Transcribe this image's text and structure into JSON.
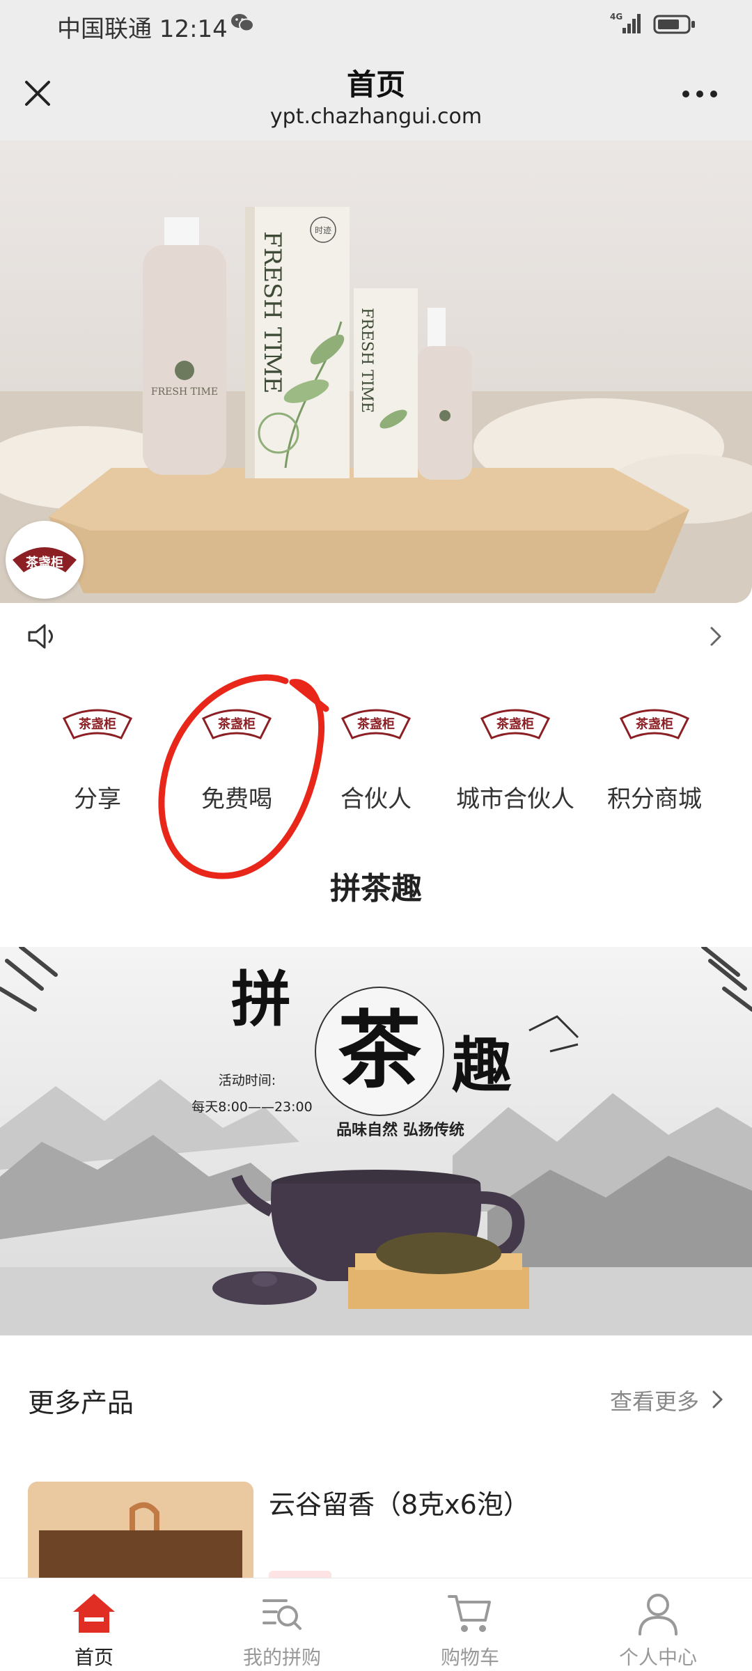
{
  "status_bar": {
    "carrier_time": "中国联通 12:14",
    "network": "4G"
  },
  "header": {
    "title": "首页",
    "url": "ypt.chazhangui.com"
  },
  "hero_banner": {
    "product_text": "FRESH TIME",
    "brand_mark": "时迹"
  },
  "brand": {
    "logo_text": "茶盏柜",
    "color": "#8b1f24"
  },
  "quick_nav": [
    {
      "label": "分享"
    },
    {
      "label": "免费喝"
    },
    {
      "label": "合伙人"
    },
    {
      "label": "城市合伙人"
    },
    {
      "label": "积分商城"
    }
  ],
  "section_title": "拼茶趣",
  "tea_banner": {
    "char1": "拼",
    "char2": "茶",
    "char3": "趣",
    "time_label": "活动时间:",
    "time_value": "每天8:00——23:00",
    "slogan": "品味自然 弘扬传统"
  },
  "more_products": {
    "title": "更多产品",
    "link": "查看更多"
  },
  "products": [
    {
      "name": "云谷留香（8克x6泡）"
    }
  ],
  "tabbar": [
    {
      "label": "首页",
      "icon": "home-icon",
      "active": true
    },
    {
      "label": "我的拼购",
      "icon": "search-list-icon",
      "active": false
    },
    {
      "label": "购物车",
      "icon": "cart-icon",
      "active": false
    },
    {
      "label": "个人中心",
      "icon": "user-icon",
      "active": false
    }
  ],
  "colors": {
    "accent": "#e02e24",
    "annotation": "#e8271a",
    "header_bg": "#ededed"
  }
}
